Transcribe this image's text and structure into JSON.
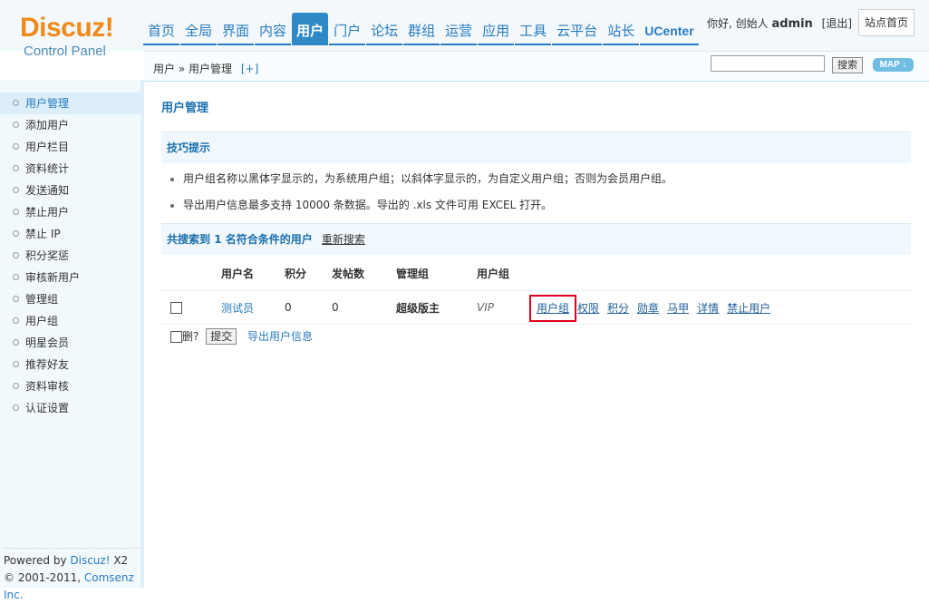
{
  "logo": {
    "brand": "Discuz!",
    "subtitle": "Control Panel"
  },
  "nav": {
    "items": [
      {
        "label": "首页"
      },
      {
        "label": "全局"
      },
      {
        "label": "界面"
      },
      {
        "label": "内容"
      },
      {
        "label": "用户",
        "active": true
      },
      {
        "label": "门户"
      },
      {
        "label": "论坛"
      },
      {
        "label": "群组"
      },
      {
        "label": "运营"
      },
      {
        "label": "应用"
      },
      {
        "label": "工具"
      },
      {
        "label": "云平台"
      },
      {
        "label": "站长"
      },
      {
        "label": "UCenter"
      }
    ]
  },
  "user": {
    "greeting": "你好, 创始人",
    "name": "admin",
    "logout": "[退出]",
    "site_home": "站点首页"
  },
  "breadcrumb": {
    "root": "用户",
    "sep": "»",
    "current": "用户管理",
    "add": "[+]"
  },
  "search": {
    "value": "",
    "button": "搜索",
    "map_button": "MAP ↓"
  },
  "sidebar": {
    "items": [
      {
        "label": "用户管理",
        "active": true
      },
      {
        "label": "添加用户"
      },
      {
        "label": "用户栏目"
      },
      {
        "label": "资料统计"
      },
      {
        "label": "发送通知"
      },
      {
        "label": "禁止用户"
      },
      {
        "label": "禁止 IP"
      },
      {
        "label": "积分奖惩"
      },
      {
        "label": "审核新用户"
      },
      {
        "label": "管理组"
      },
      {
        "label": "用户组"
      },
      {
        "label": "明星会员"
      },
      {
        "label": "推荐好友"
      },
      {
        "label": "资料审核"
      },
      {
        "label": "认证设置"
      }
    ],
    "powered_prefix": "Powered by ",
    "powered_link": "Discuz!",
    "powered_version": " X2",
    "copyright_prefix": "© 2001-2011, ",
    "copyright_link": "Comsenz Inc."
  },
  "main": {
    "title": "用户管理",
    "tips_title": "技巧提示",
    "tips": [
      "用户组名称以黑体字显示的，为系统用户组；以斜体字显示的，为自定义用户组；否则为会员用户组。",
      "导出用户信息最多支持 10000 条数据。导出的 .xls 文件可用 EXCEL 打开。"
    ],
    "result_prefix": "共搜索到 ",
    "result_count": "1",
    "result_suffix": " 名符合条件的用户",
    "research": "重新搜索",
    "columns": [
      "用户名",
      "积分",
      "发帖数",
      "管理组",
      "用户组"
    ],
    "rows": [
      {
        "username": "测试员",
        "credits": "0",
        "posts": "0",
        "admin_group": "超级版主",
        "user_group": "VIP",
        "actions": [
          "用户组",
          "权限",
          "积分",
          "勋章",
          "马甲",
          "详情",
          "禁止用户"
        ]
      }
    ],
    "delete_label": "删?",
    "submit_label": "提交",
    "export_label": "导出用户信息"
  },
  "colors": {
    "accent": "#2f89c6",
    "highlight": "#e0001b",
    "logo": "#ef8a1b"
  }
}
